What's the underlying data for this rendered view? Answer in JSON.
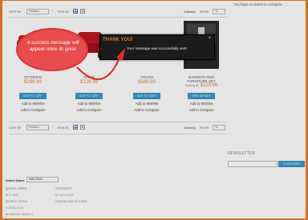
{
  "header": {
    "no_items_text": "You have no items to compare."
  },
  "toolbar": {
    "sort_label": "SORT BY",
    "sort_value": "Position",
    "sort_direction_icon": "up-arrow-icon",
    "view_label": "VIEW AS",
    "items_text": "4 Item(s)",
    "show_label": "SHOW",
    "show_value": "12"
  },
  "products": [
    {
      "name": "OTTOMAN",
      "price": "$299.99",
      "price_label": "",
      "button": "ADD TO CART",
      "wishlist": "Add to Wishlist",
      "compare": "Add to Compare"
    },
    {
      "name": "CHAIR",
      "price": "$129.99",
      "price_label": "",
      "button": "ADD TO CART",
      "wishlist": "Add to Wishlist",
      "compare": "Add to Compare"
    },
    {
      "name": "COUCH",
      "price": "$599.99",
      "price_label": "",
      "button": "ADD TO CART",
      "wishlist": "Add to Wishlist",
      "compare": "Add to Compare"
    },
    {
      "name": "MAGENTO RED FURNITURE SET",
      "price": "$129.99",
      "price_label": "Starting at:",
      "button": "VIEW DETAILS",
      "wishlist": "Add to Wishlist",
      "compare": "Add to Compare"
    }
  ],
  "newsletter": {
    "title": "NEWSLETTER",
    "button": "SUBSCRIBE"
  },
  "footer": {
    "store_label": "Select Store:",
    "store_value": "Main Store",
    "quick_links_title": "QUICK LINKS",
    "account_title": "ACCOUNT",
    "quick_links": [
      "SITE MAP",
      "SEARCH TERMS",
      "CONTACT US",
      "ADVANCED SEARCH"
    ],
    "account_links": [
      "MY ACCOUNT",
      "ORDERS AND RETURNS"
    ]
  },
  "modal": {
    "title": "THANK YOU!",
    "message": "Your message was successfully sent.",
    "close_icon": "close-icon"
  },
  "callout": {
    "text": "A success message will appear once its gone"
  },
  "colors": {
    "accent": "#f47a24",
    "button": "#3399cc",
    "modal_bg": "#1b1b1b",
    "callout": "#e84c4c"
  }
}
